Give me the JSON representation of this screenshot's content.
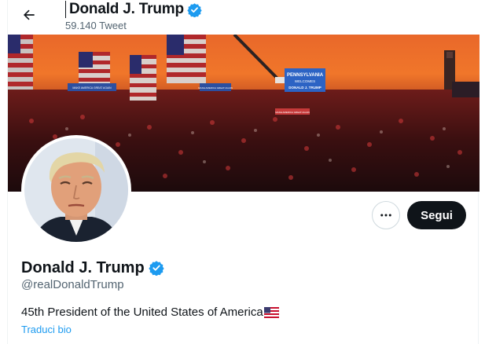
{
  "header": {
    "name": "Donald J. Trump",
    "tweet_count": "59.140 Tweet"
  },
  "banner": {
    "sign_main_line1": "PENNSYLVANIA",
    "sign_main_line2": "WELCOMES",
    "sign_main_line3": "DONALD J. TRUMP",
    "sign_left": "MAKE AMERICA GREAT AGAIN",
    "sign_center": "MAKE AMERICA GREAT AGAIN",
    "sign_small": "MAKE AMERICA GREAT AGAIN"
  },
  "actions": {
    "more_icon": "more-horizontal-icon",
    "follow_label": "Segui"
  },
  "profile": {
    "name": "Donald J. Trump",
    "handle": "@realDonaldTrump",
    "bio": "45th President of the United States of America",
    "bio_flag": "flag-us-icon",
    "translate_label": "Traduci bio"
  },
  "colors": {
    "verified": "#1d9bf0",
    "follow_bg": "#0f1419",
    "link": "#1d9bf0",
    "secondary_text": "#536471"
  }
}
